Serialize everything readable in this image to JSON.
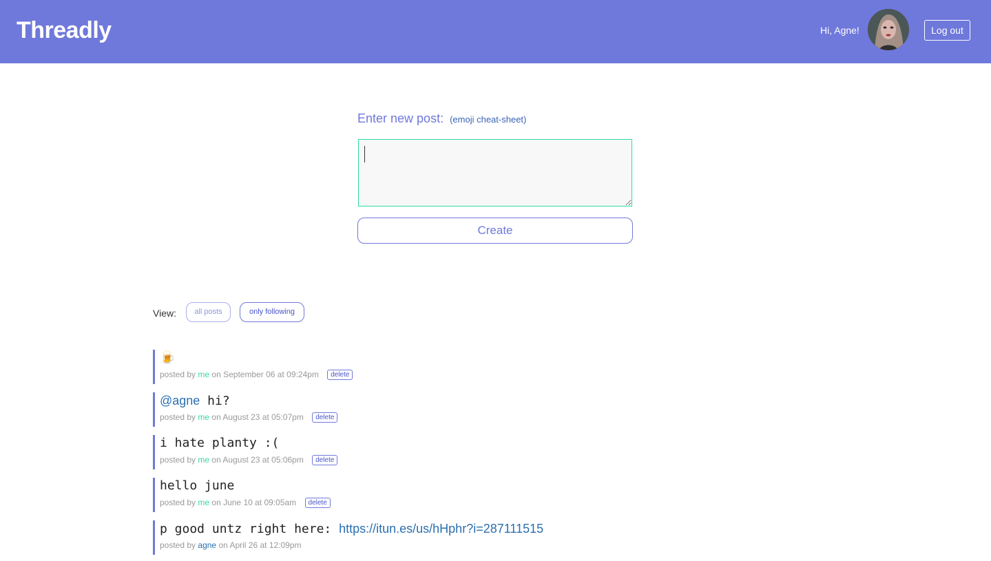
{
  "header": {
    "brand": "Threadly",
    "greeting": "Hi, Agne!",
    "logout_label": "Log out"
  },
  "composer": {
    "label": "Enter new post:",
    "cheat_sheet_link": "(emoji cheat-sheet)",
    "input_value": "",
    "create_label": "Create"
  },
  "view": {
    "label": "View:",
    "all_label": "all posts",
    "following_label": "only following"
  },
  "posts": [
    {
      "emoji": "🍺",
      "by_label": "posted by",
      "author": "me",
      "date": "on September 06 at 09:24pm",
      "delete_label": "delete"
    },
    {
      "mention": "@agne",
      "text": "hi?",
      "by_label": "posted by",
      "author": "me",
      "date": "on August 23 at 05:07pm",
      "delete_label": "delete"
    },
    {
      "text": "i hate planty :(",
      "by_label": "posted by",
      "author": "me",
      "date": "on August 23 at 05:06pm",
      "delete_label": "delete"
    },
    {
      "text": "hello june",
      "by_label": "posted by",
      "author": "me",
      "date": "on June 10 at 09:05am",
      "delete_label": "delete"
    },
    {
      "text": "p good untz right here:",
      "link": "https://itun.es/us/hHphr?i=287111515",
      "by_label": "posted by",
      "author": "agne",
      "date": "on April 26 at 12:09pm"
    }
  ],
  "colors": {
    "brand": "#6f78db",
    "accent_green": "#2fd9a6",
    "link_blue": "#2a6fb0"
  },
  "icons": {
    "avatar": "user-avatar-photo",
    "post_0_emoji": "beer-mug-emoji"
  }
}
